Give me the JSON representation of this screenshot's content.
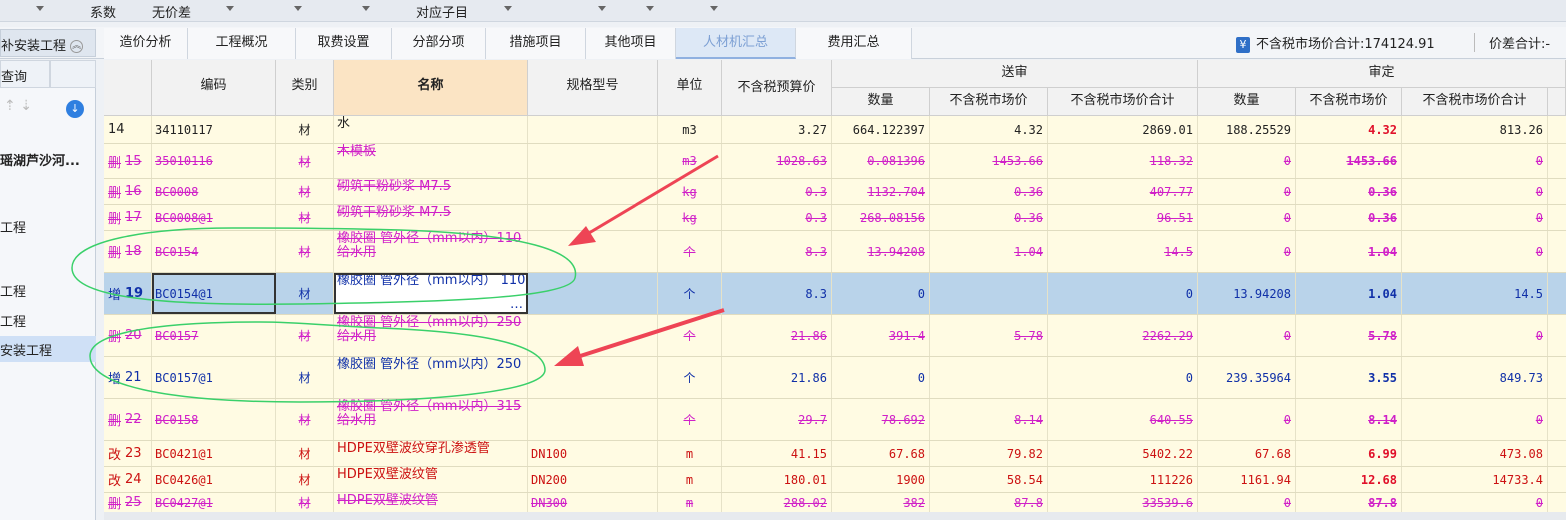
{
  "topbar": [
    {
      "label": "系数"
    },
    {
      "label": "无价差"
    },
    {
      "label": "对应子目"
    }
  ],
  "left_header": "补安装工程",
  "tabs": [
    "造价分析",
    "工程概况",
    "取费设置",
    "分部分项",
    "措施项目",
    "其他项目",
    "人材机汇总",
    "费用汇总"
  ],
  "active_tab": "人材机汇总",
  "totals": {
    "market_total": "不含税市场价合计:174124.91",
    "diff_total": "价差合计:-"
  },
  "sidebar": {
    "query": "查询",
    "items": [
      "瑶湖芦沙河...",
      "工程",
      "工程",
      "工程",
      "安装工程"
    ]
  },
  "columns": {
    "code": "编码",
    "type": "类别",
    "name": "名称",
    "spec": "规格型号",
    "unit": "单位",
    "budget": "不含税预算价",
    "sub_group": "送审",
    "aud_group": "审定",
    "sub_qty": "数量",
    "sub_price": "不含税市场价",
    "sub_total": "不含税市场价合计",
    "aud_qty": "数量",
    "aud_price": "不含税市场价",
    "aud_total": "不含税市场价合计"
  },
  "rows": [
    {
      "tag": "",
      "idx": "14",
      "code": "34110117",
      "type": "材",
      "name": "水",
      "spec": "",
      "unit": "m3",
      "budget": "3.27",
      "sq": "664.122397",
      "sp": "4.32",
      "st": "2869.01",
      "aq": "188.25529",
      "ap": "4.32",
      "at": "813.26",
      "style": "norm"
    },
    {
      "tag": "删",
      "idx": "15",
      "code": "35010116",
      "type": "材",
      "name": "木模板",
      "spec": "",
      "unit": "m3",
      "budget": "1028.63",
      "sq": "0.081396",
      "sp": "1453.66",
      "st": "118.32",
      "aq": "0",
      "ap": "1453.66",
      "at": "0",
      "style": "del"
    },
    {
      "tag": "删",
      "idx": "16",
      "code": "BC0008",
      "type": "材",
      "name": "砌筑干粉砂浆 M7.5",
      "spec": "",
      "unit": "kg",
      "budget": "0.3",
      "sq": "1132.704",
      "sp": "0.36",
      "st": "407.77",
      "aq": "0",
      "ap": "0.36",
      "at": "0",
      "style": "del"
    },
    {
      "tag": "删",
      "idx": "17",
      "code": "BC0008@1",
      "type": "材",
      "name": "砌筑干粉砂浆 M7.5",
      "spec": "",
      "unit": "kg",
      "budget": "0.3",
      "sq": "268.08156",
      "sp": "0.36",
      "st": "96.51",
      "aq": "0",
      "ap": "0.36",
      "at": "0",
      "style": "del"
    },
    {
      "tag": "删",
      "idx": "18",
      "code": "BC0154",
      "type": "材",
      "name": "橡胶圈 管外径（mm以内）110 给水用",
      "spec": "",
      "unit": "个",
      "budget": "8.3",
      "sq": "13.94208",
      "sp": "1.04",
      "st": "14.5",
      "aq": "0",
      "ap": "1.04",
      "at": "0",
      "style": "del"
    },
    {
      "tag": "增",
      "idx": "19",
      "code": "BC0154@1",
      "type": "材",
      "name": "橡胶圈 管外径（mm以内） 110",
      "spec": "",
      "unit": "个",
      "budget": "8.3",
      "sq": "0",
      "sp": "",
      "st": "0",
      "aq": "13.94208",
      "ap": "1.04",
      "at": "14.5",
      "style": "add"
    },
    {
      "tag": "删",
      "idx": "20",
      "code": "BC0157",
      "type": "材",
      "name": "橡胶圈 管外径（mm以内）250 给水用",
      "spec": "",
      "unit": "个",
      "budget": "21.86",
      "sq": "391.4",
      "sp": "5.78",
      "st": "2262.29",
      "aq": "0",
      "ap": "5.78",
      "at": "0",
      "style": "del"
    },
    {
      "tag": "增",
      "idx": "21",
      "code": "BC0157@1",
      "type": "材",
      "name": "橡胶圈 管外径（mm以内）250",
      "spec": "",
      "unit": "个",
      "budget": "21.86",
      "sq": "0",
      "sp": "",
      "st": "0",
      "aq": "239.35964",
      "ap": "3.55",
      "at": "849.73",
      "style": "add"
    },
    {
      "tag": "删",
      "idx": "22",
      "code": "BC0158",
      "type": "材",
      "name": "橡胶圈 管外径（mm以内）315 给水用",
      "spec": "",
      "unit": "个",
      "budget": "29.7",
      "sq": "78.692",
      "sp": "8.14",
      "st": "640.55",
      "aq": "0",
      "ap": "8.14",
      "at": "0",
      "style": "del"
    },
    {
      "tag": "改",
      "idx": "23",
      "code": "BC0421@1",
      "type": "材",
      "name": "HDPE双壁波纹穿孔渗透管",
      "spec": "DN100",
      "unit": "m",
      "budget": "41.15",
      "sq": "67.68",
      "sp": "79.82",
      "st": "5402.22",
      "aq": "67.68",
      "ap": "6.99",
      "at": "473.08",
      "style": "chg"
    },
    {
      "tag": "改",
      "idx": "24",
      "code": "BC0426@1",
      "type": "材",
      "name": "HDPE双壁波纹管",
      "spec": "DN200",
      "unit": "m",
      "budget": "180.01",
      "sq": "1900",
      "sp": "58.54",
      "st": "111226",
      "aq": "1161.94",
      "ap": "12.68",
      "at": "14733.4",
      "style": "chg"
    },
    {
      "tag": "删",
      "idx": "25",
      "code": "BC0427@1",
      "type": "材",
      "name": "HDPE双壁波纹管",
      "spec": "DN300",
      "unit": "m",
      "budget": "288.02",
      "sq": "382",
      "sp": "87.8",
      "st": "33539.6",
      "aq": "0",
      "ap": "87.8",
      "at": "0",
      "style": "del"
    }
  ],
  "colors": {
    "delete": "#d020c8",
    "add": "#1030a8",
    "change": "#cc1111",
    "arrow": "#ee4455",
    "annotation": "#3ad06a"
  }
}
